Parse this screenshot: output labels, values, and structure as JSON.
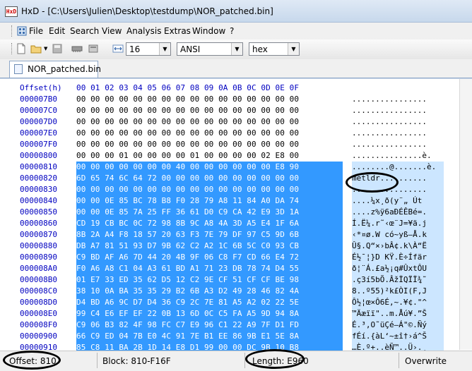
{
  "window": {
    "title": "HxD - [C:\\Users\\Julien\\Desktop\\testdump\\NOR_patched.bin]",
    "app_icon_text": "HxD"
  },
  "menu": [
    "File",
    "Edit",
    "Search",
    "View",
    "Analysis",
    "Extras",
    "Window",
    "?"
  ],
  "toolbar": {
    "bytes_per_row": "16",
    "charset": "ANSI",
    "offset_base": "hex"
  },
  "tab": {
    "label": "NOR_patched.bin"
  },
  "hex_view": {
    "header_offset": "Offset(h)",
    "column_headers": "00 01 02 03 04 05 06 07 08 09 0A 0B 0C 0D 0E 0F",
    "rows": [
      {
        "offset": "000007B0",
        "hex": "00 00 00 00 00 00 00 00 00 00 00 00 00 00 00 00",
        "ascii": "................",
        "sel": false
      },
      {
        "offset": "000007C0",
        "hex": "00 00 00 00 00 00 00 00 00 00 00 00 00 00 00 00",
        "ascii": "................",
        "sel": false
      },
      {
        "offset": "000007D0",
        "hex": "00 00 00 00 00 00 00 00 00 00 00 00 00 00 00 00",
        "ascii": "................",
        "sel": false
      },
      {
        "offset": "000007E0",
        "hex": "00 00 00 00 00 00 00 00 00 00 00 00 00 00 00 00",
        "ascii": "................",
        "sel": false
      },
      {
        "offset": "000007F0",
        "hex": "00 00 00 00 00 00 00 00 00 00 00 00 00 00 00 00",
        "ascii": "................",
        "sel": false
      },
      {
        "offset": "00000800",
        "hex": "00 00 00 01 00 00 00 00 01 00 00 00 00 02 E8 00",
        "ascii": "...............è.",
        "sel": false
      },
      {
        "offset": "00000810",
        "hex": "00 00 00 00 00 00 00 40 00 00 00 00 00 00 E8 90",
        "ascii": "........@.......è.",
        "sel": true
      },
      {
        "offset": "00000820",
        "hex": "6D 65 74 6C 64 72 00 00 00 00 00 00 00 00 00 00",
        "ascii": "metldr..........",
        "sel": true
      },
      {
        "offset": "00000830",
        "hex": "00 00 00 00 00 00 00 00 00 00 00 00 00 00 00 00",
        "ascii": "................",
        "sel": true
      },
      {
        "offset": "00000840",
        "hex": "00 00 0E 85 BC 78 B8 F0 28 79 A8 11 84 A0 DA 74",
        "ascii": "....¼x¸ð(y¨„ Út",
        "sel": true
      },
      {
        "offset": "00000850",
        "hex": "00 00 0E 85 7A 25 FF 36 61 D0 C9 CA 42 E9 3D 1A",
        "ascii": "....z%ÿ6aÐÉÊBé=.",
        "sel": true
      },
      {
        "offset": "00000860",
        "hex": "CD 19 CB BC 0C 72 98 8B 9C A8 4A 3D A5 E4 1F 6A",
        "ascii": "Í.Ë¼.r˜‹œ¨J=¥ä.j",
        "sel": true
      },
      {
        "offset": "00000870",
        "hex": "8B 2A A4 F8 18 57 20 63 F3 7E 79 DF 97 C5 9D 6B",
        "ascii": "‹*¤ø.W có~yß—Å.k",
        "sel": true
      },
      {
        "offset": "00000880",
        "hex": "DB A7 81 51 93 D7 9B 62 C2 A2 1C 6B 5C C0 93 CB",
        "ascii": "Û§.Q“×›bÂ¢.k\\À“Ë",
        "sel": true
      },
      {
        "offset": "00000890",
        "hex": "C9 BD AF A6 7D 44 20 4B 9F 06 C8 F7 CD 66 E4 72",
        "ascii": "É½¯¦}D KŸ.È÷Ífär",
        "sel": true
      },
      {
        "offset": "000008A0",
        "hex": "F0 A6 A8 C1 04 A3 61 BD A1 71 23 DB 78 74 D4 55",
        "ascii": "ð¦¨Á.£a½¡q#ÛxtÔU",
        "sel": true
      },
      {
        "offset": "000008B0",
        "hex": "01 E7 33 ED 35 62 D5 12 C2 9E CF 51 CF CF BE 98",
        "ascii": ".ç3í5bÕ.ÂžÏQÏÏ¾˜",
        "sel": true
      },
      {
        "offset": "000008C0",
        "hex": "38 10 0A BA 35 35 29 B2 6B A3 D2 49 28 46 82 4A",
        "ascii": "8..º55)²k£ÒI(F‚J",
        "sel": true
      },
      {
        "offset": "000008D0",
        "hex": "D4 BD A6 9C D7 D4 36 C9 2C 7E 81 A5 A2 02 22 5E",
        "ascii": "Ô½¦œ×Ô6É,~.¥¢.\"^",
        "sel": true
      },
      {
        "offset": "000008E0",
        "hex": "99 C4 E6 EF EF 22 0B 13 6D 0C C5 FA A5 9D 94 8A",
        "ascii": "™Äæïï\"..m.Åú¥.”Š",
        "sel": true
      },
      {
        "offset": "000008F0",
        "hex": "C9 06 B3 82 4F 98 FC C7 E9 96 C1 22 A9 7F D1 FD",
        "ascii": "É.³‚O˜üÇé–Á\"©.Ñý",
        "sel": true
      },
      {
        "offset": "00000900",
        "hex": "66 C9 ED 04 7B E0 4C 91 7E B1 EE 86 9B E1 5E 8A",
        "ascii": "fÉí.{àL‘~±î†›á^Š",
        "sel": true
      },
      {
        "offset": "00000910",
        "hex": "85 C8 11 BA 2B 1D 14 E8 D1 99 00 00 DC 9B 10 B8",
        "ascii": "…È.º+..èÑ™..Ü›.¸",
        "sel": true
      }
    ]
  },
  "status": {
    "offset": "Offset: 810",
    "block": "Block: 810-F16F",
    "length": "Length: E960",
    "mode": "Overwrite"
  }
}
